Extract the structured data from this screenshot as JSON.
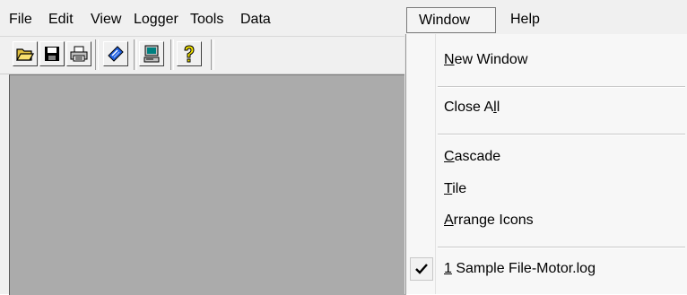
{
  "menubar": {
    "items": [
      "File",
      "Edit",
      "View",
      "Logger",
      "Tools",
      "Data",
      "Window",
      "Help"
    ],
    "active": "Window"
  },
  "toolbar": {
    "buttons": [
      "open-folder-icon",
      "save-disk-icon",
      "print-icon",
      "logger-tag-icon",
      "computer-icon",
      "help-question-icon"
    ]
  },
  "window_menu": {
    "new_window": {
      "accel": "N",
      "rest": "ew Window"
    },
    "close_all": {
      "pre": "Close A",
      "accel": "l",
      "rest": "l"
    },
    "cascade": {
      "accel": "C",
      "rest": "ascade"
    },
    "tile": {
      "accel": "T",
      "rest": "ile"
    },
    "arrange_icons": {
      "accel": "A",
      "rest": "rrange Icons"
    },
    "recent_file": {
      "accel": "1",
      "rest": " Sample File-Motor.log",
      "checked": true
    }
  },
  "colors": {
    "workspace": "#ababab",
    "menubar": "#f0f0f0",
    "dropdown": "#f7f7f7"
  }
}
